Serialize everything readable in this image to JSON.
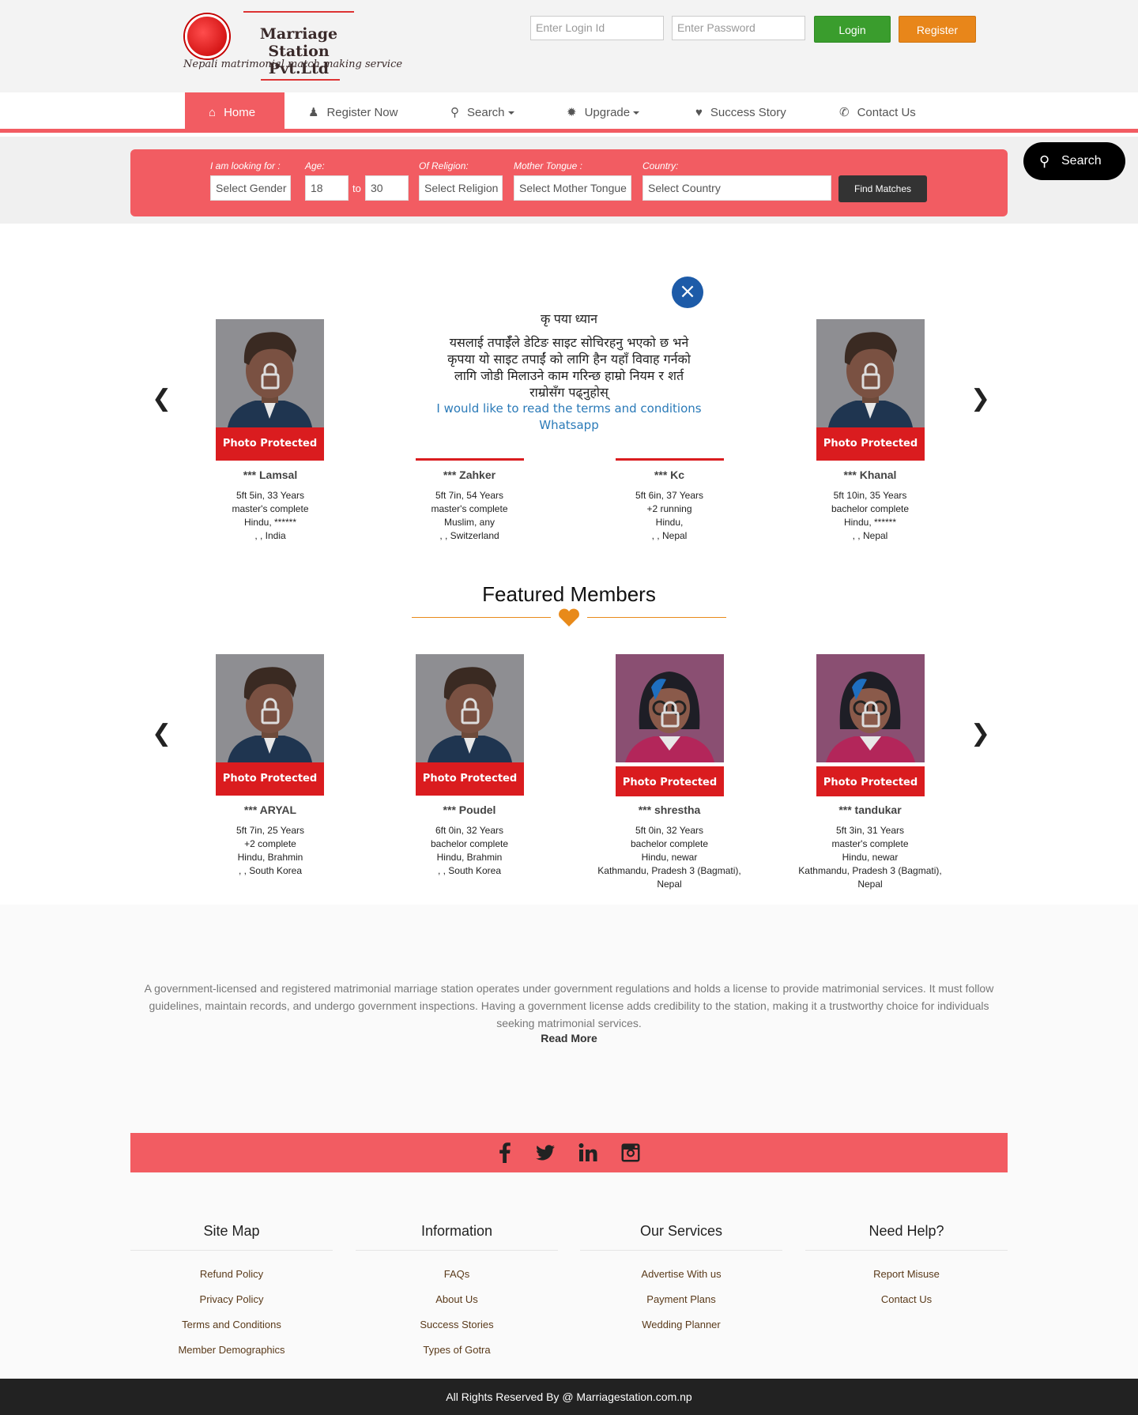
{
  "logo": {
    "title": "Marriage Station Pvt.Ltd",
    "tagline": "Nepali matrimonial match making service"
  },
  "login": {
    "id_placeholder": "Enter Login Id",
    "password_placeholder": "Enter Password",
    "login_label": "Login",
    "register_label": "Register"
  },
  "nav": [
    {
      "label": "Home",
      "icon": "home-icon"
    },
    {
      "label": "Register Now",
      "icon": "user-icon"
    },
    {
      "label": "Search",
      "icon": "search-icon"
    },
    {
      "label": "Upgrade",
      "icon": "gear-icon"
    },
    {
      "label": "Success Story",
      "icon": "heart-icon"
    },
    {
      "label": "Contact Us",
      "icon": "phone-icon"
    }
  ],
  "search_form": {
    "gender_label": "I am looking for :",
    "gender_value": "Select Gender",
    "age_label": "Age:",
    "age_from": "18",
    "age_to_label": "to",
    "age_to": "30",
    "religion_label": "Of Religion:",
    "religion_value": "Select Religion",
    "tongue_label": "Mother Tongue :",
    "tongue_value": "Select Mother Tongue",
    "country_label": "Country:",
    "country_value": "Select Country",
    "find_label": "Find Matches",
    "floating_search": "Search"
  },
  "popup": {
    "title": "कृ पया ध्यान",
    "text": "यसलाई तपाईँले डेटिङ साइट सोचिरहनु भएको छ भने कृपया यो साइट तपाईं को लागि हैन यहाँ विवाह गर्नको लागि जोडी मिलाउने काम गरिन्छ हाम्रो नियम र शर्त राम्रोसँग पढ्नुहोस्",
    "terms_link": "I would like to read the terms and conditions",
    "whatsapp_link": "Whatsapp"
  },
  "photo_protected_label": "Photo Protected",
  "recent_members": [
    {
      "name": "*** Lamsal",
      "height_age": "5ft 5in, 33 Years",
      "education": "master's complete",
      "religion": "Hindu, ******",
      "location": ", , India"
    },
    {
      "name": "*** Zahker",
      "height_age": "5ft 7in, 54 Years",
      "education": "master's complete",
      "religion": "Muslim, any",
      "location": ", , Switzerland"
    },
    {
      "name": "*** Kc",
      "height_age": "5ft 6in, 37 Years",
      "education": "+2 running",
      "religion": "Hindu,",
      "location": ", , Nepal"
    },
    {
      "name": "*** Khanal",
      "height_age": "5ft 10in, 35 Years",
      "education": "bachelor complete",
      "religion": "Hindu, ******",
      "location": ", , Nepal"
    }
  ],
  "featured": {
    "title": "Featured Members",
    "members": [
      {
        "name": "*** ARYAL",
        "height_age": "5ft 7in, 25 Years",
        "education": "+2 complete",
        "religion": "Hindu, Brahmin",
        "location": ", , South Korea",
        "gender": "male"
      },
      {
        "name": "*** Poudel",
        "height_age": "6ft 0in, 32 Years",
        "education": "bachelor complete",
        "religion": "Hindu, Brahmin",
        "location": ", , South Korea",
        "gender": "male"
      },
      {
        "name": "*** shrestha",
        "height_age": "5ft 0in, 32 Years",
        "education": "bachelor complete",
        "religion": "Hindu, newar",
        "location": "Kathmandu, Pradesh 3 (Bagmati), Nepal",
        "gender": "female"
      },
      {
        "name": "*** tandukar",
        "height_age": "5ft 3in, 31 Years",
        "education": "master's complete",
        "religion": "Hindu, newar",
        "location": "Kathmandu, Pradesh 3 (Bagmati), Nepal",
        "gender": "female"
      }
    ]
  },
  "about": {
    "text": "A government-licensed and registered matrimonial marriage station operates under government regulations and holds a license to provide matrimonial services. It must follow guidelines, maintain records, and undergo government inspections. Having a government license adds credibility to the station, making it a trustworthy choice for individuals seeking matrimonial services.",
    "read_more": "Read More"
  },
  "social": [
    "facebook-icon",
    "twitter-icon",
    "linkedin-icon",
    "instagram-icon"
  ],
  "footer": {
    "columns": [
      {
        "title": "Site Map",
        "links": [
          "Refund Policy",
          "Privacy Policy",
          "Terms and Conditions",
          "Member Demographics"
        ]
      },
      {
        "title": "Information",
        "links": [
          "FAQs",
          "About Us",
          "Success Stories",
          "Types of Gotra"
        ]
      },
      {
        "title": "Our Services",
        "links": [
          "Advertise With us",
          "Payment Plans",
          "Wedding Planner"
        ]
      },
      {
        "title": "Need Help?",
        "links": [
          "Report Misuse",
          "Contact Us"
        ]
      }
    ],
    "copyright": "All Rights Reserved By @ Marriagestation.com.np"
  },
  "colors": {
    "brand_red": "#f25c62",
    "login_green": "#3a9d2d",
    "register_orange": "#e8861a",
    "photo_band": "#da1c1f",
    "close_blue": "#1d5ba8",
    "featured_accent": "#e88a1a"
  }
}
